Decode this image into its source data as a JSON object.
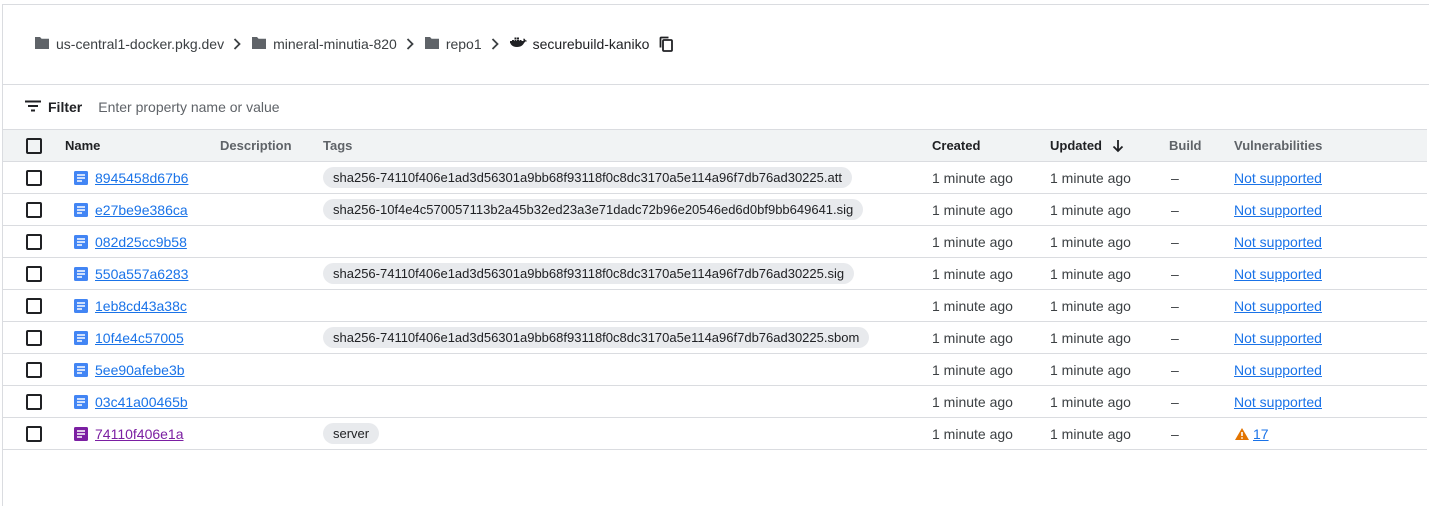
{
  "breadcrumb": {
    "items": [
      {
        "label": "us-central1-docker.pkg.dev",
        "icon": "folder-icon"
      },
      {
        "label": "mineral-minutia-820",
        "icon": "folder-icon"
      },
      {
        "label": "repo1",
        "icon": "folder-icon"
      },
      {
        "label": "securebuild-kaniko",
        "icon": "docker-icon"
      }
    ],
    "copy_icon": "copy-icon"
  },
  "filter": {
    "label": "Filter",
    "placeholder": "Enter property name or value",
    "value": ""
  },
  "table": {
    "columns": {
      "name": "Name",
      "description": "Description",
      "tags": "Tags",
      "created": "Created",
      "updated": "Updated",
      "build": "Build",
      "vulnerabilities": "Vulnerabilities"
    },
    "sort": {
      "column": "updated",
      "direction": "descending"
    },
    "rows": [
      {
        "name": "8945458d67b6",
        "description": "",
        "tag": "sha256-74110f406e1ad3d56301a9bb68f93118f0c8dc3170a5e114a96f7db76ad30225.att",
        "created": "1 minute ago",
        "updated": "1 minute ago",
        "build": "–",
        "vulnerabilities": "Not supported"
      },
      {
        "name": "e27be9e386ca",
        "description": "",
        "tag": "sha256-10f4e4c570057113b2a45b32ed23a3e71dadc72b96e20546ed6d0bf9bb649641.sig",
        "created": "1 minute ago",
        "updated": "1 minute ago",
        "build": "–",
        "vulnerabilities": "Not supported"
      },
      {
        "name": "082d25cc9b58",
        "description": "",
        "tag": "",
        "created": "1 minute ago",
        "updated": "1 minute ago",
        "build": "–",
        "vulnerabilities": "Not supported"
      },
      {
        "name": "550a557a6283",
        "description": "",
        "tag": "sha256-74110f406e1ad3d56301a9bb68f93118f0c8dc3170a5e114a96f7db76ad30225.sig",
        "created": "1 minute ago",
        "updated": "1 minute ago",
        "build": "–",
        "vulnerabilities": "Not supported"
      },
      {
        "name": "1eb8cd43a38c",
        "description": "",
        "tag": "",
        "created": "1 minute ago",
        "updated": "1 minute ago",
        "build": "–",
        "vulnerabilities": "Not supported"
      },
      {
        "name": "10f4e4c57005",
        "description": "",
        "tag": "sha256-74110f406e1ad3d56301a9bb68f93118f0c8dc3170a5e114a96f7db76ad30225.sbom",
        "created": "1 minute ago",
        "updated": "1 minute ago",
        "build": "–",
        "vulnerabilities": "Not supported"
      },
      {
        "name": "5ee90afebe3b",
        "description": "",
        "tag": "",
        "created": "1 minute ago",
        "updated": "1 minute ago",
        "build": "–",
        "vulnerabilities": "Not supported"
      },
      {
        "name": "03c41a00465b",
        "description": "",
        "tag": "",
        "created": "1 minute ago",
        "updated": "1 minute ago",
        "build": "–",
        "vulnerabilities": "Not supported"
      },
      {
        "name": "74110f406e1a",
        "description": "",
        "tag": "server",
        "created": "1 minute ago",
        "updated": "1 minute ago",
        "build": "–",
        "vulnerabilities": "17",
        "vuln_icon": "warning-icon"
      }
    ]
  },
  "colors": {
    "link_blue": "#1a73e8",
    "image_purple": "#7b1fa2",
    "doc_icon_blue": "#4285f4",
    "warning_orange": "#e37400",
    "header_bg": "#f1f3f4",
    "chip_bg": "#e8eaed"
  }
}
